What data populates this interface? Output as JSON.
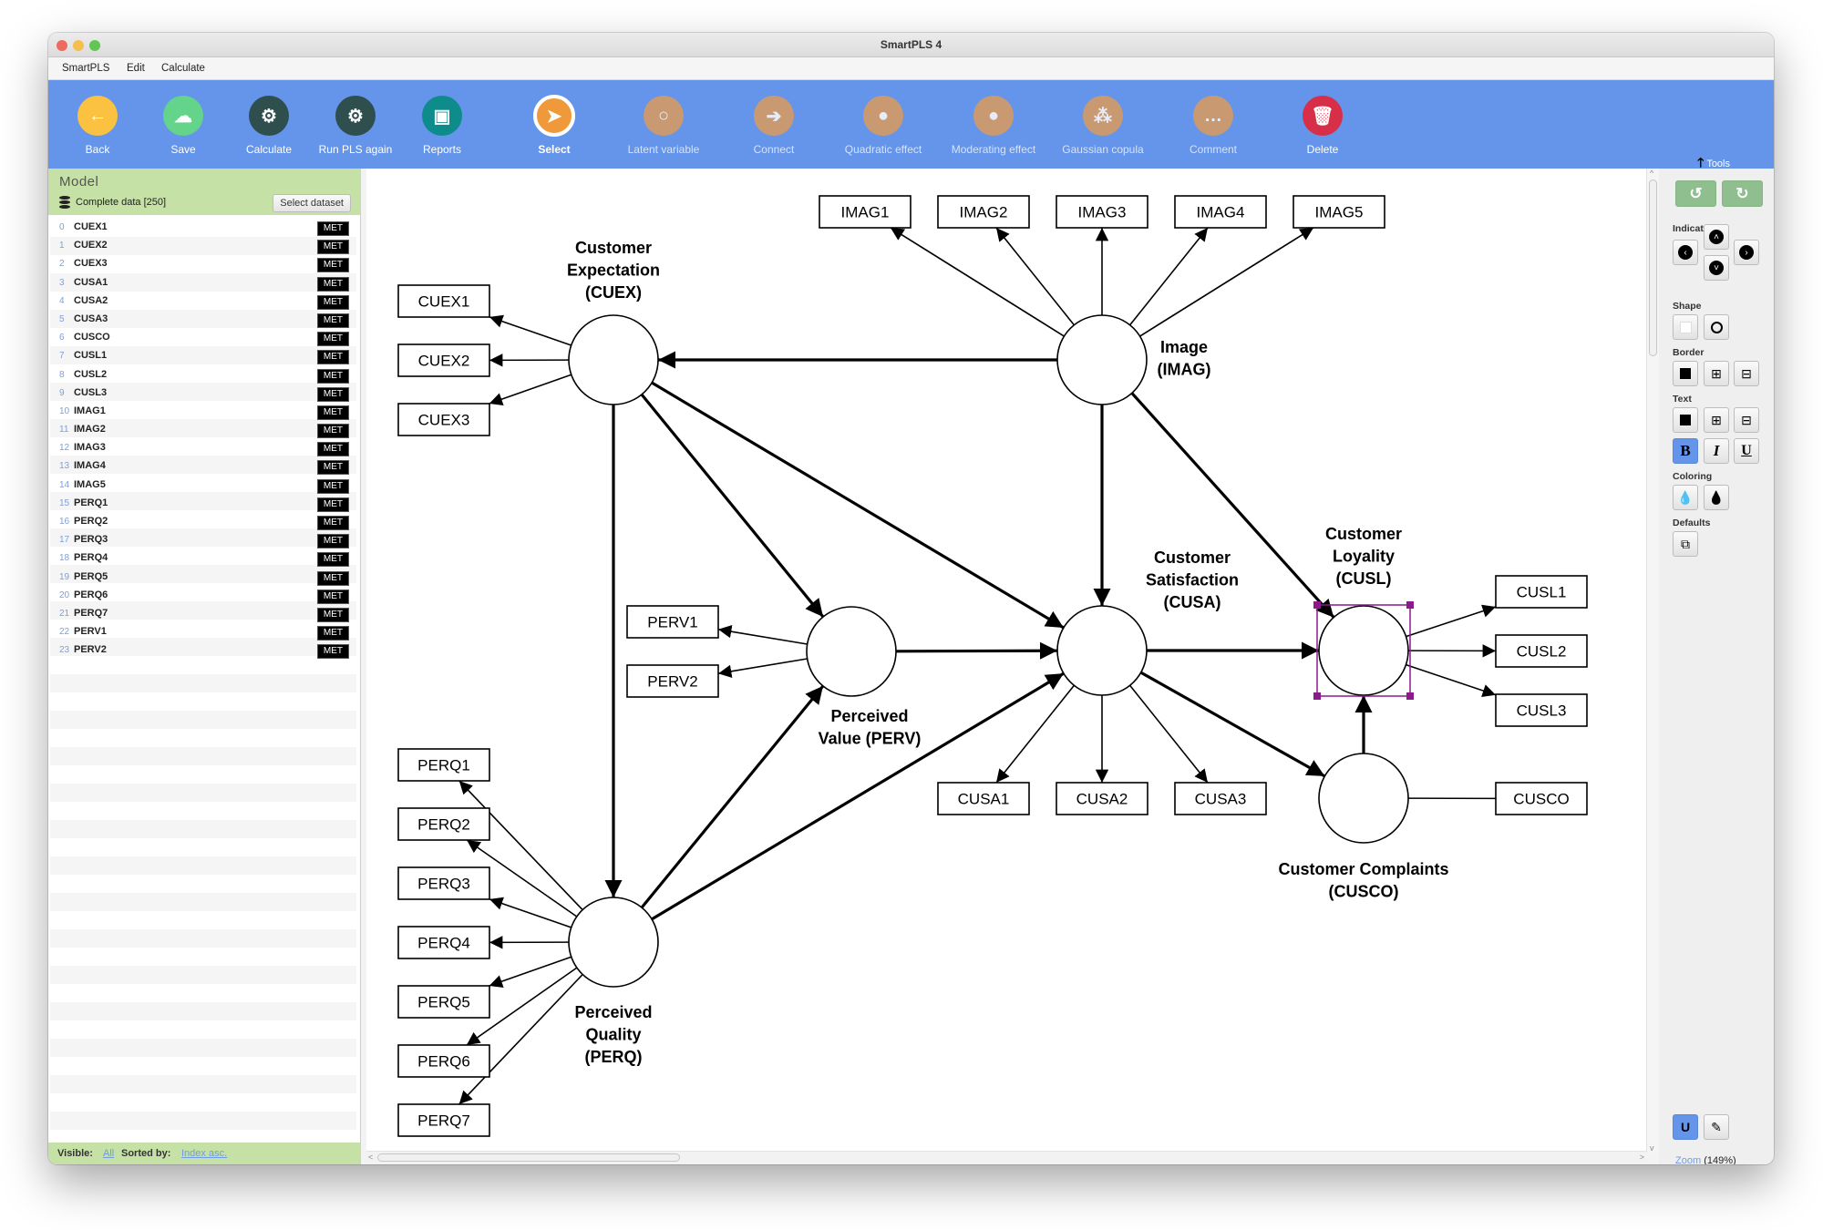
{
  "window": {
    "title": "SmartPLS 4",
    "traffic_lights": [
      {
        "name": "close",
        "color": "#ee6a5f"
      },
      {
        "name": "minimize",
        "color": "#f5bf4f"
      },
      {
        "name": "zoom",
        "color": "#62c554"
      }
    ]
  },
  "menu": [
    "SmartPLS",
    "Edit",
    "Calculate"
  ],
  "toolbar": {
    "buttons": [
      {
        "id": "back",
        "label": "Back",
        "icon": "arrow-left-icon",
        "glyph": "←",
        "color": "#fbc140",
        "state": "enabled"
      },
      {
        "id": "save",
        "label": "Save",
        "icon": "cloud-upload-icon",
        "glyph": "☁",
        "color": "#63d48a",
        "state": "enabled"
      },
      {
        "id": "calculate",
        "label": "Calculate",
        "icon": "gear-icon",
        "glyph": "⚙",
        "color": "#2f4f4f",
        "state": "enabled"
      },
      {
        "id": "run-pls-again",
        "label": "Run PLS again",
        "icon": "gears-icon",
        "glyph": "⚙",
        "color": "#2f4f4f",
        "state": "enabled"
      },
      {
        "id": "reports",
        "label": "Reports",
        "icon": "address-book-icon",
        "glyph": "▣",
        "color": "#0e8c8c",
        "state": "enabled"
      },
      {
        "id": "select",
        "label": "Select",
        "icon": "pointer-icon",
        "glyph": "➤",
        "color": "#f0993a",
        "state": "active"
      },
      {
        "id": "latent-variable",
        "label": "Latent variable",
        "icon": "circle-outline-icon",
        "glyph": "○",
        "color": "#c99a72",
        "state": "disabled"
      },
      {
        "id": "connect",
        "label": "Connect",
        "icon": "arrow-right-icon",
        "glyph": "➔",
        "color": "#c99a72",
        "state": "disabled"
      },
      {
        "id": "quadratic-effect",
        "label": "Quadratic effect",
        "icon": "user-icon",
        "glyph": "●",
        "color": "#c99a72",
        "state": "disabled"
      },
      {
        "id": "moderating-effect",
        "label": "Moderating effect",
        "icon": "user-icon",
        "glyph": "●",
        "color": "#c99a72",
        "state": "disabled"
      },
      {
        "id": "gaussian-copula",
        "label": "Gaussian copula",
        "icon": "users-icon",
        "glyph": "⁂",
        "color": "#c99a72",
        "state": "disabled"
      },
      {
        "id": "comment",
        "label": "Comment",
        "icon": "comment-icon",
        "glyph": "…",
        "color": "#c99a72",
        "state": "disabled"
      },
      {
        "id": "delete",
        "label": "Delete",
        "icon": "trash-icon",
        "glyph": "🗑",
        "color": "#d72f48",
        "state": "enabled"
      }
    ],
    "tools_toggle": "Tools"
  },
  "left_panel": {
    "title": "Model",
    "dataset": "Complete data [250]",
    "select_dataset_label": "Select dataset",
    "indicators": [
      {
        "index": "0",
        "name": "CUEX1",
        "scale": "MET"
      },
      {
        "index": "1",
        "name": "CUEX2",
        "scale": "MET"
      },
      {
        "index": "2",
        "name": "CUEX3",
        "scale": "MET"
      },
      {
        "index": "3",
        "name": "CUSA1",
        "scale": "MET"
      },
      {
        "index": "4",
        "name": "CUSA2",
        "scale": "MET"
      },
      {
        "index": "5",
        "name": "CUSA3",
        "scale": "MET"
      },
      {
        "index": "6",
        "name": "CUSCO",
        "scale": "MET"
      },
      {
        "index": "7",
        "name": "CUSL1",
        "scale": "MET"
      },
      {
        "index": "8",
        "name": "CUSL2",
        "scale": "MET"
      },
      {
        "index": "9",
        "name": "CUSL3",
        "scale": "MET"
      },
      {
        "index": "10",
        "name": "IMAG1",
        "scale": "MET"
      },
      {
        "index": "11",
        "name": "IMAG2",
        "scale": "MET"
      },
      {
        "index": "12",
        "name": "IMAG3",
        "scale": "MET"
      },
      {
        "index": "13",
        "name": "IMAG4",
        "scale": "MET"
      },
      {
        "index": "14",
        "name": "IMAG5",
        "scale": "MET"
      },
      {
        "index": "15",
        "name": "PERQ1",
        "scale": "MET"
      },
      {
        "index": "16",
        "name": "PERQ2",
        "scale": "MET"
      },
      {
        "index": "17",
        "name": "PERQ3",
        "scale": "MET"
      },
      {
        "index": "18",
        "name": "PERQ4",
        "scale": "MET"
      },
      {
        "index": "19",
        "name": "PERQ5",
        "scale": "MET"
      },
      {
        "index": "20",
        "name": "PERQ6",
        "scale": "MET"
      },
      {
        "index": "21",
        "name": "PERQ7",
        "scale": "MET"
      },
      {
        "index": "22",
        "name": "PERV1",
        "scale": "MET"
      },
      {
        "index": "23",
        "name": "PERV2",
        "scale": "MET"
      }
    ],
    "footer": {
      "visible_label": "Visible:",
      "visible_value": "All",
      "sorted_label": "Sorted by:",
      "sorted_value": "Index asc."
    }
  },
  "model": {
    "selected_construct": "CUSL",
    "selection_color": "#8b1a8b",
    "constructs": [
      {
        "id": "CUEX",
        "label": [
          "Customer",
          "Expectation",
          "(CUEX)"
        ]
      },
      {
        "id": "IMAG",
        "label": [
          "Image",
          "(IMAG)"
        ]
      },
      {
        "id": "PERV",
        "label": [
          "Perceived",
          "Value (PERV)"
        ]
      },
      {
        "id": "CUSA",
        "label": [
          "Customer",
          "Satisfaction",
          "(CUSA)"
        ]
      },
      {
        "id": "CUSL",
        "label": [
          "Customer",
          "Loyality",
          "(CUSL)"
        ]
      },
      {
        "id": "CUSCO",
        "label": [
          "Customer Complaints",
          "(CUSCO)"
        ]
      },
      {
        "id": "PERQ",
        "label": [
          "Perceived",
          "Quality",
          "(PERQ)"
        ]
      }
    ],
    "indicator_boxes": [
      {
        "id": "IMAG1",
        "construct": "IMAG",
        "direction": "reflective"
      },
      {
        "id": "IMAG2",
        "construct": "IMAG",
        "direction": "reflective"
      },
      {
        "id": "IMAG3",
        "construct": "IMAG",
        "direction": "reflective"
      },
      {
        "id": "IMAG4",
        "construct": "IMAG",
        "direction": "reflective"
      },
      {
        "id": "IMAG5",
        "construct": "IMAG",
        "direction": "reflective"
      },
      {
        "id": "CUEX1",
        "construct": "CUEX",
        "direction": "reflective"
      },
      {
        "id": "CUEX2",
        "construct": "CUEX",
        "direction": "reflective"
      },
      {
        "id": "CUEX3",
        "construct": "CUEX",
        "direction": "reflective"
      },
      {
        "id": "PERV1",
        "construct": "PERV",
        "direction": "reflective"
      },
      {
        "id": "PERV2",
        "construct": "PERV",
        "direction": "reflective"
      },
      {
        "id": "CUSA1",
        "construct": "CUSA",
        "direction": "reflective"
      },
      {
        "id": "CUSA2",
        "construct": "CUSA",
        "direction": "reflective"
      },
      {
        "id": "CUSA3",
        "construct": "CUSA",
        "direction": "reflective"
      },
      {
        "id": "CUSL1",
        "construct": "CUSL",
        "direction": "reflective"
      },
      {
        "id": "CUSL2",
        "construct": "CUSL",
        "direction": "reflective"
      },
      {
        "id": "CUSL3",
        "construct": "CUSL",
        "direction": "reflective"
      },
      {
        "id": "CUSCO",
        "construct": "CUSCO",
        "direction": "single"
      },
      {
        "id": "PERQ1",
        "construct": "PERQ",
        "direction": "reflective"
      },
      {
        "id": "PERQ2",
        "construct": "PERQ",
        "direction": "reflective"
      },
      {
        "id": "PERQ3",
        "construct": "PERQ",
        "direction": "reflective"
      },
      {
        "id": "PERQ4",
        "construct": "PERQ",
        "direction": "reflective"
      },
      {
        "id": "PERQ5",
        "construct": "PERQ",
        "direction": "reflective"
      },
      {
        "id": "PERQ6",
        "construct": "PERQ",
        "direction": "reflective"
      },
      {
        "id": "PERQ7",
        "construct": "PERQ",
        "direction": "reflective"
      }
    ],
    "paths": [
      {
        "from": "IMAG",
        "to": "CUEX"
      },
      {
        "from": "IMAG",
        "to": "CUSA"
      },
      {
        "from": "IMAG",
        "to": "CUSL"
      },
      {
        "from": "CUEX",
        "to": "PERQ"
      },
      {
        "from": "CUEX",
        "to": "PERV"
      },
      {
        "from": "CUEX",
        "to": "CUSA"
      },
      {
        "from": "PERQ",
        "to": "PERV"
      },
      {
        "from": "PERQ",
        "to": "CUSA"
      },
      {
        "from": "PERV",
        "to": "CUSA"
      },
      {
        "from": "CUSA",
        "to": "CUSL"
      },
      {
        "from": "CUSA",
        "to": "CUSCO"
      },
      {
        "from": "CUSCO",
        "to": "CUSL"
      }
    ]
  },
  "right_panel": {
    "undo_icon": "undo-icon",
    "redo_icon": "redo-icon",
    "sections": {
      "indicators": "Indicators",
      "shape": "Shape",
      "border": "Border",
      "text": "Text",
      "coloring": "Coloring",
      "defaults": "Defaults"
    },
    "text_style_active": "bold",
    "zoom_link": "Zoom",
    "zoom_value": "(149%)",
    "zoom_slider_fraction": 0.33
  }
}
